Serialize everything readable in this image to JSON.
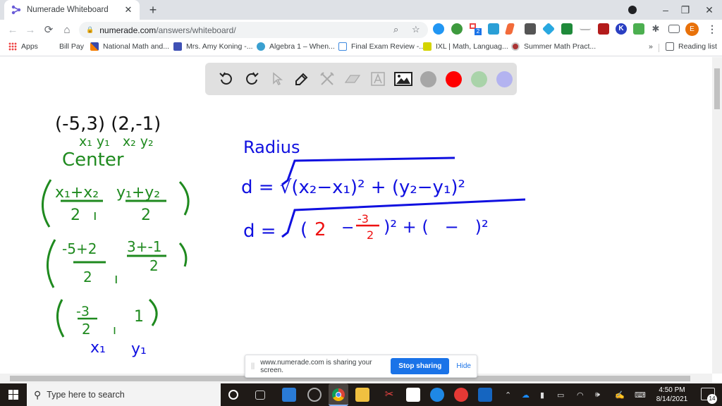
{
  "browser": {
    "tab_title": "Numerade Whiteboard",
    "new_tab_symbol": "+",
    "url_host": "numerade.com",
    "url_path": "/answers/whiteboard/",
    "profile_initial": "E",
    "extension_badge": "2"
  },
  "bookmarks": {
    "items": [
      {
        "label": "Apps",
        "icon": "apps-grid-icon"
      },
      {
        "label": "Bill Pay",
        "icon": ""
      },
      {
        "label": "National Math and...",
        "icon": "national-math-icon"
      },
      {
        "label": "Mrs. Amy Koning -...",
        "icon": "calendar-icon"
      },
      {
        "label": "Algebra 1 – When...",
        "icon": "wordpress-icon"
      },
      {
        "label": "Final Exam Review -...",
        "icon": "forms-icon"
      },
      {
        "label": "IXL | Math, Languag...",
        "icon": "ixl-icon"
      },
      {
        "label": "Summer Math Pract...",
        "icon": "summer-math-icon"
      }
    ],
    "overflow": "»",
    "reading_list": "Reading list"
  },
  "whiteboard_toolbar": {
    "tools": [
      "undo",
      "redo",
      "select",
      "pen",
      "tools",
      "eraser",
      "text",
      "image"
    ],
    "colors": [
      "#a6a6a6",
      "#ff0000",
      "#a9d3a9",
      "#b3b3f0"
    ],
    "selected_color": "#ff0000"
  },
  "whiteboard": {
    "ink_black": "#111111",
    "ink_green": "#1f8a1f",
    "ink_blue": "#1010e0",
    "ink_red": "#ee1111",
    "points": "(-5,3) (2,-1)",
    "point_labels": "x₁ y₁   x₂ y₂",
    "center_label": "Center",
    "midpoint_formula": {
      "x_num": "x₁+x₂",
      "y_num": "y₁+y₂",
      "den": "2"
    },
    "midpoint_sub": {
      "x_num": "-5+2",
      "y_num": "3+-1",
      "den": "2"
    },
    "midpoint_result": {
      "x_num": "-3",
      "x_den": "2",
      "y": "1"
    },
    "result_labels": {
      "x": "x₁",
      "y": "y₁"
    },
    "radius_label": "Radius",
    "distance_formula": "d = √(x₂−x₁)² + (y₂−y₁)²",
    "distance_sub": {
      "prefix": "d =",
      "a": "2",
      "minus": "−",
      "frac_num": "-3",
      "frac_den": "2",
      "rest": ")² + (   −   )²"
    }
  },
  "share_bar": {
    "message": "www.numerade.com is sharing your screen.",
    "stop_label": "Stop sharing",
    "hide_label": "Hide"
  },
  "taskbar": {
    "search_placeholder": "Type here to search",
    "time": "4:50 PM",
    "date": "8/14/2021",
    "notification_count": "14"
  }
}
